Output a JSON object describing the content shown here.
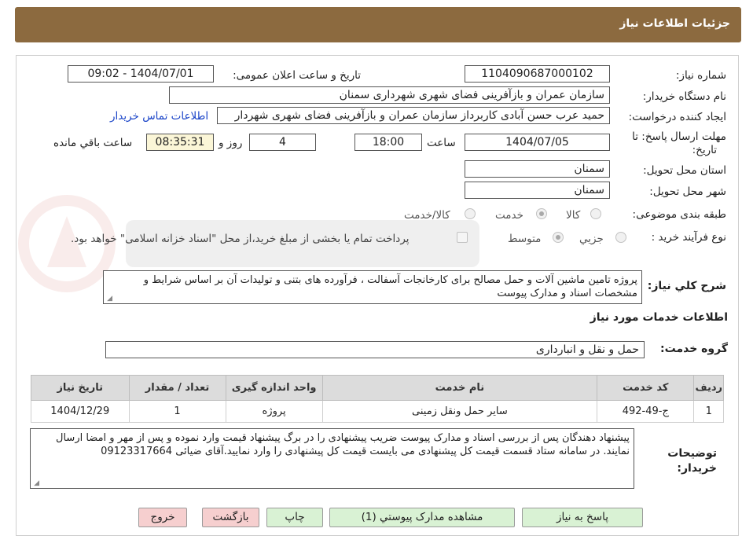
{
  "header": {
    "title": "جزئیات اطلاعات نیاز"
  },
  "form": {
    "need_number_label": "شماره نیاز:",
    "need_number": "1104090687000102",
    "announce_label": "تاریخ و ساعت اعلان عمومی:",
    "announce_value": "1404/07/01 - 09:02",
    "buyer_org_label": "نام دستگاه خریدار:",
    "buyer_org": "سازمان عمران و بازآفرینی فضای شهری شهرداری سمنان",
    "requester_label": "ایجاد کننده درخواست:",
    "requester": "حمید عرب حسن آبادی کاربرداز سازمان عمران و بازآفرینی فضای شهری شهردار",
    "contact_link": "اطلاعات تماس خریدار",
    "deadline_label_1": "مهلت ارسال پاسخ: تا",
    "deadline_label_2": "تاریخ:",
    "deadline_date": "1404/07/05",
    "time_label": "ساعت",
    "deadline_time": "18:00",
    "days_value": "4",
    "days_label": "روز و",
    "remaining_time": "08:35:31",
    "remaining_label": "ساعت باقي مانده",
    "province_label": "استان محل تحویل:",
    "province": "سمنان",
    "city_label": "شهر محل تحویل:",
    "city": "سمنان",
    "category_label": "طبقه بندی موضوعی:",
    "category_options": {
      "goods": "کالا",
      "service": "خدمت",
      "goods_service": "کالا/خدمت"
    },
    "process_label": "نوع فرآیند خرید :",
    "process_options": {
      "partial": "جزيي",
      "medium": "متوسط"
    },
    "payment_note": "پرداخت تمام یا بخشی از مبلغ خرید،از محل \"اسناد خزانه اسلامی\" خواهد بود.",
    "summary_label": "شرح کلي نياز:",
    "summary": "پروژه تامین ماشین آلات و حمل مصالح برای کارخانجات آسفالت ، فرآورده های بتنی و تولیدات آن بر اساس شرایط و مشخصات اسناد و مدارک پیوست"
  },
  "services": {
    "section_title": "اطلاعات خدمات مورد نیاز",
    "group_label": "گروه خدمت:",
    "group_value": "حمل و نقل و انبارداری",
    "columns": [
      "ردیف",
      "کد خدمت",
      "نام خدمت",
      "واحد اندازه گیری",
      "تعداد / مقدار",
      "تاریخ نیاز"
    ],
    "rows": [
      [
        "1",
        "ج-49-492",
        "سایر حمل ونقل زمینی",
        "پروژه",
        "1",
        "1404/12/29"
      ]
    ]
  },
  "buyer_notes": {
    "label_1": "توضیحات",
    "label_2": "خریدار:",
    "text": "پیشنهاد دهندگان پس از بررسی اسناد و مدارک پیوست ضریب پیشنهادی را در برگ پیشنهاد قیمت وارد نموده و پس از مهر و امضا ارسال نمایند. در سامانه ستاد قسمت قیمت کل پیشنهادی می بایست قیمت کل پیشنهادی را وارد نمایید.آقای ضیائی 09123317664"
  },
  "buttons": {
    "respond": "پاسخ به نیاز",
    "attachments": "مشاهده مدارک پیوستي (1)",
    "print": "چاپ",
    "back": "بازگشت",
    "exit": "خروج"
  },
  "colors": {
    "header_bg": "#8c6a3f",
    "button_green": "#d9f2d4",
    "button_red": "#f6cfcf",
    "link_blue": "#1a44c8",
    "highlight_field": "#fbf6d7"
  }
}
